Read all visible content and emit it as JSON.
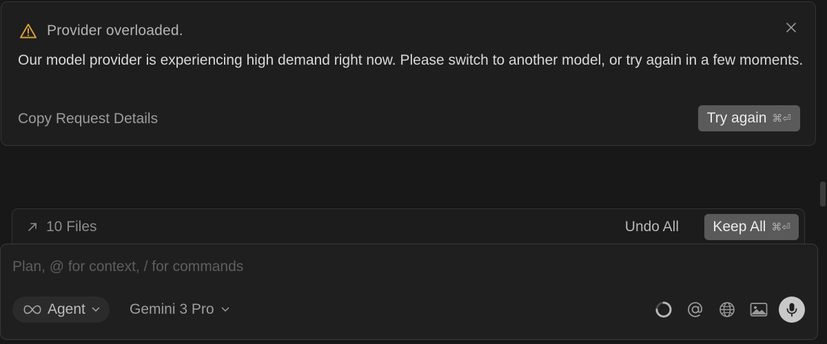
{
  "banner": {
    "title": "Provider overloaded.",
    "message": "Our model provider is experiencing high demand right now. Please switch to another model, or try again in a few moments.",
    "copy_label": "Copy Request Details",
    "try_again_label": "Try again",
    "try_again_shortcut": "⌘⏎",
    "warning_color": "#d9a23a"
  },
  "files_bar": {
    "label": "10 Files",
    "undo_all_label": "Undo All",
    "keep_all_label": "Keep All",
    "keep_all_shortcut": "⌘⏎"
  },
  "composer": {
    "placeholder": "Plan, @ for context, / for commands",
    "value": "",
    "agent_label": "Agent",
    "model_label": "Gemini 3 Pro"
  },
  "icons": {
    "warning": "warning-icon",
    "close": "close-icon",
    "expand": "arrow-up-right-icon",
    "infinity": "infinity-icon",
    "chevron": "chevron-down-icon",
    "loading": "loading-spinner-icon",
    "mention": "at-sign-icon",
    "web": "globe-icon",
    "image": "image-icon",
    "mic": "microphone-icon"
  }
}
